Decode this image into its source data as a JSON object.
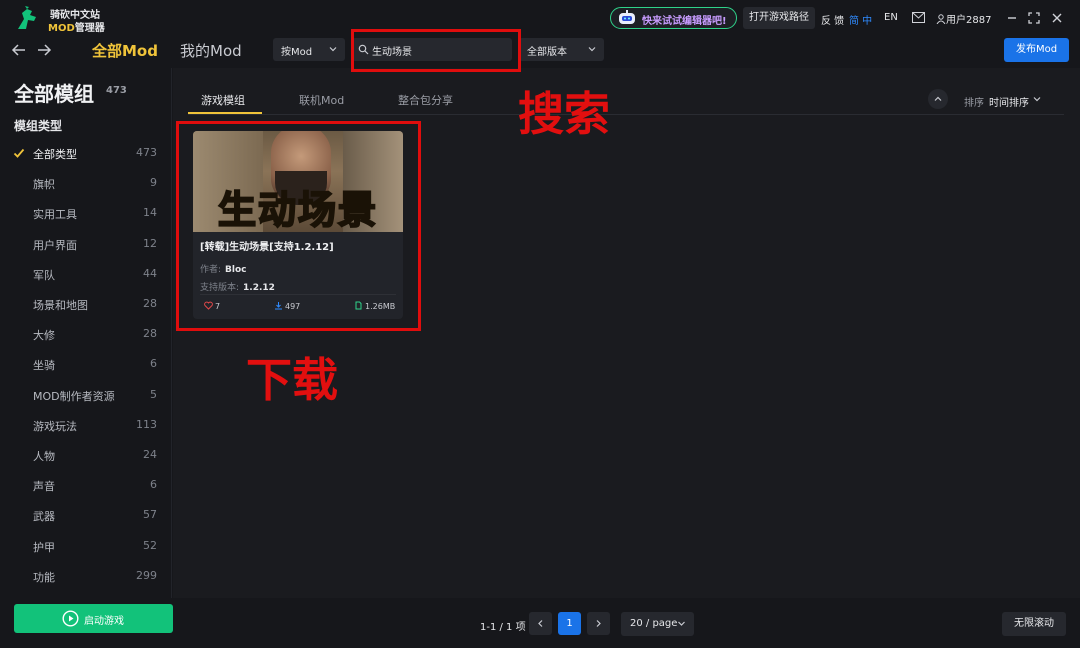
{
  "app": {
    "name_line1": "骑砍中文站",
    "name_mod": "MOD",
    "name_line2_rest": "管理器"
  },
  "titlebar": {
    "ai_promo": "快来试试编辑器吧!",
    "open_game_path": "打开游戏路径",
    "feedback": "反 馈",
    "lang_zh": "简 中",
    "lang_en": "EN",
    "user": "用户2887"
  },
  "nav": {
    "tab_all": "全部Mod",
    "tab_mine": "我的Mod",
    "filter_by": "按Mod",
    "search_value": "生动场景",
    "version_filter": "全部版本",
    "publish": "发布Mod"
  },
  "sidebar": {
    "title": "全部模组",
    "total": "473",
    "section": "模组类型",
    "categories": [
      {
        "name": "全部类型",
        "count": "473",
        "active": true
      },
      {
        "name": "旗帜",
        "count": "9"
      },
      {
        "name": "实用工具",
        "count": "14"
      },
      {
        "name": "用户界面",
        "count": "12"
      },
      {
        "name": "军队",
        "count": "44"
      },
      {
        "name": "场景和地图",
        "count": "28"
      },
      {
        "name": "大修",
        "count": "28"
      },
      {
        "name": "坐骑",
        "count": "6"
      },
      {
        "name": "MOD制作者资源",
        "count": "5"
      },
      {
        "name": "游戏玩法",
        "count": "113"
      },
      {
        "name": "人物",
        "count": "24"
      },
      {
        "name": "声音",
        "count": "6"
      },
      {
        "name": "武器",
        "count": "57"
      },
      {
        "name": "护甲",
        "count": "52"
      },
      {
        "name": "功能",
        "count": "299"
      }
    ],
    "launch_game": "启动游戏"
  },
  "content": {
    "tabs": [
      "游戏模组",
      "联机Mod",
      "整合包分享"
    ],
    "sort_label": "排序",
    "sort_value": "时间排序"
  },
  "card": {
    "thumb_caption": "生动场景",
    "title": "[转载]生动场景[支持1.2.12]",
    "author_label": "作者:",
    "author": "Bloc",
    "version_label": "支持版本:",
    "version": "1.2.12",
    "likes": "7",
    "downloads": "497",
    "size": "1.26MB"
  },
  "annotations": {
    "search": "搜索",
    "download": "下载"
  },
  "pagination": {
    "info": "1-1 / 1 项",
    "current_page": "1",
    "page_size": "20 / page",
    "infinite_scroll": "无限滚动"
  },
  "colors": {
    "accent": "#f0c43a",
    "primary": "#1a73e8",
    "launch": "#12c27a",
    "annotation": "#e00d0d"
  }
}
